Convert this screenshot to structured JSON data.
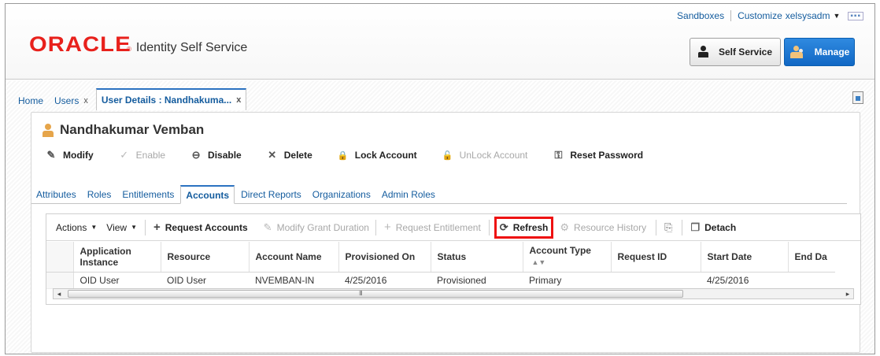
{
  "header": {
    "links": [
      "Sandboxes",
      "Customize"
    ],
    "username": "xelsysadm",
    "more_glyph": "▪▪▪",
    "logo_text": "ORACLE",
    "product_name": "Identity Self Service",
    "self_service_label": "Self Service",
    "manage_label": "Manage",
    "brand_color": "#e8211c",
    "accent_color": "#1168c4"
  },
  "breadcrumb_tabs": [
    {
      "label": "Home",
      "closable": false
    },
    {
      "label": "Users",
      "closable": true
    },
    {
      "label": "User Details : Nandhakuma...",
      "closable": true,
      "active": true
    }
  ],
  "close_glyph": "x",
  "user": {
    "full_name": "Nandhakumar Vemban"
  },
  "actions": [
    {
      "label": "Modify",
      "icon": "pencil-icon",
      "glyph": "✎",
      "enabled": true
    },
    {
      "label": "Enable",
      "icon": "check-icon",
      "glyph": "✓",
      "enabled": false
    },
    {
      "label": "Disable",
      "icon": "minus-circle-icon",
      "glyph": "⊖",
      "enabled": true
    },
    {
      "label": "Delete",
      "icon": "x-icon",
      "glyph": "✕",
      "enabled": true
    },
    {
      "label": "Lock Account",
      "icon": "lock-icon",
      "glyph": "🔒",
      "enabled": true
    },
    {
      "label": "UnLock Account",
      "icon": "unlock-icon",
      "glyph": "🔓",
      "enabled": false
    },
    {
      "label": "Reset Password",
      "icon": "key-icon",
      "glyph": "⚿",
      "enabled": true
    }
  ],
  "subtabs": [
    "Attributes",
    "Roles",
    "Entitlements",
    "Accounts",
    "Direct Reports",
    "Organizations",
    "Admin Roles"
  ],
  "active_subtab": "Accounts",
  "toolbar": {
    "actions_label": "Actions",
    "view_label": "View",
    "request_accounts": "Request Accounts",
    "modify_grant_duration": "Modify Grant Duration",
    "request_entitlement": "Request Entitlement",
    "refresh": "Refresh",
    "resource_history": "Resource History",
    "detach": "Detach"
  },
  "table": {
    "columns": [
      "Application Instance",
      "Resource",
      "Account Name",
      "Provisioned On",
      "Status",
      "Account Type",
      "Request ID",
      "Start Date",
      "End Da"
    ],
    "rows": [
      [
        "OID User",
        "OID User",
        "NVEMBAN-IN",
        "4/25/2016",
        "Provisioned",
        "Primary",
        "",
        "4/25/2016",
        ""
      ]
    ]
  },
  "scrollbar": {
    "grip": "III",
    "left_arrow": "◂",
    "right_arrow": "▸"
  }
}
